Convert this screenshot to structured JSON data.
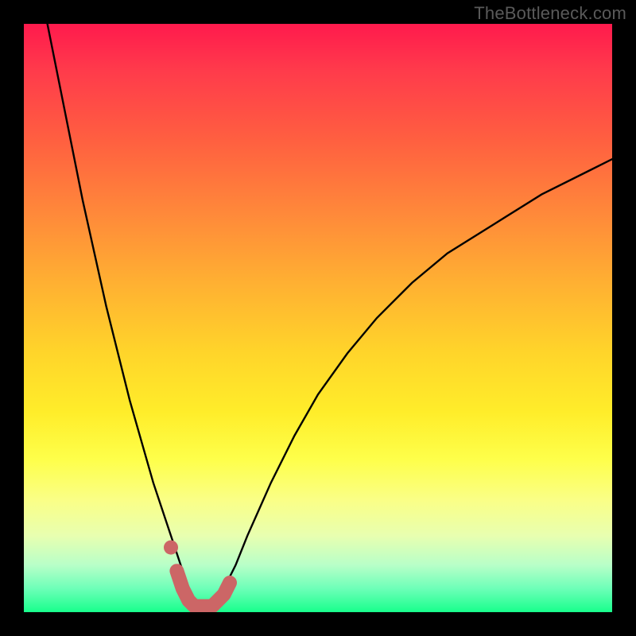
{
  "watermark": "TheBottleneck.com",
  "chart_data": {
    "type": "line",
    "title": "",
    "xlabel": "",
    "ylabel": "",
    "xlim": [
      0,
      100
    ],
    "ylim": [
      0,
      100
    ],
    "series": [
      {
        "name": "bottleneck-curve",
        "x": [
          4,
          6,
          8,
          10,
          12,
          14,
          16,
          18,
          20,
          22,
          24,
          26,
          27,
          28,
          29,
          30,
          31,
          32,
          33,
          34,
          36,
          38,
          42,
          46,
          50,
          55,
          60,
          66,
          72,
          80,
          88,
          96,
          100
        ],
        "values": [
          100,
          90,
          80,
          70,
          61,
          52,
          44,
          36,
          29,
          22,
          16,
          10,
          7,
          4,
          2,
          1,
          1,
          1,
          2,
          4,
          8,
          13,
          22,
          30,
          37,
          44,
          50,
          56,
          61,
          66,
          71,
          75,
          77
        ]
      },
      {
        "name": "optimal-band",
        "x": [
          25,
          26,
          27,
          28,
          29,
          30,
          31,
          32,
          33,
          34,
          35
        ],
        "values": [
          11,
          7,
          4,
          2,
          1,
          1,
          1,
          1,
          2,
          3,
          5
        ]
      }
    ],
    "colors": {
      "curve": "#000000",
      "band": "#cc6666",
      "band_dot": "#cc6666"
    }
  }
}
